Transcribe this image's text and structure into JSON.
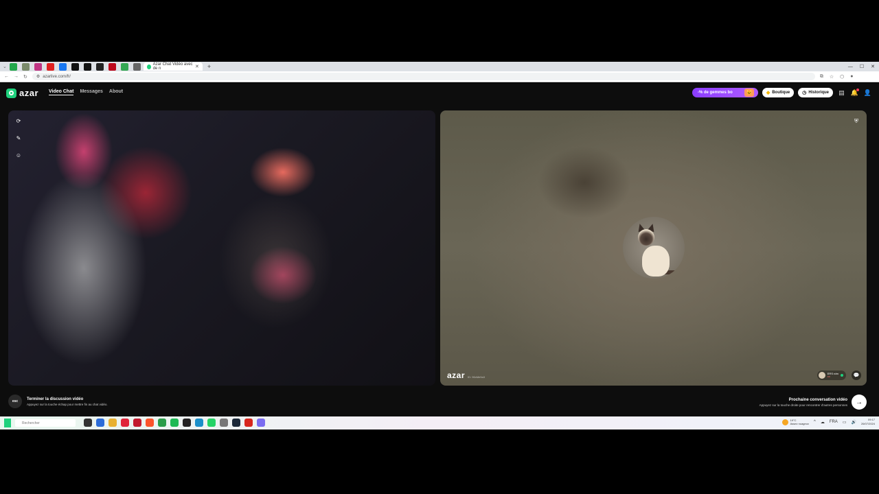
{
  "browser": {
    "active_tab_title": "Azar Chat Vidéo avec de n",
    "url": "azarlive.com/fr/",
    "tab_favicons": [
      {
        "icon": "green-square-icon",
        "color": "#22a84b"
      },
      {
        "icon": "shield-icon",
        "color": "#7a8a6a"
      },
      {
        "icon": "instagram-icon",
        "color": "#c13584"
      },
      {
        "icon": "youtube-icon",
        "color": "#e02020"
      },
      {
        "icon": "facebook-icon",
        "color": "#1877f2"
      },
      {
        "icon": "x-icon",
        "color": "#111111"
      },
      {
        "icon": "x-icon",
        "color": "#111111"
      },
      {
        "icon": "grid-icon",
        "color": "#222222"
      },
      {
        "icon": "pinterest-icon",
        "color": "#bd081c"
      },
      {
        "icon": "drive-icon",
        "color": "#34a853"
      },
      {
        "icon": "gear-icon",
        "color": "#666666"
      }
    ]
  },
  "app": {
    "logo": "azar",
    "nav": {
      "video_chat": "Video Chat",
      "messages": "Messages",
      "about": "About"
    },
    "promo_label": "-% de gemmes bo",
    "boutique_label": "Boutique",
    "historique_label": "Historique",
    "remote": {
      "watermark_logo": "azar",
      "watermark_id": "ID: 96xMe9a3",
      "username": "ERS rdm",
      "username_sub": "FR",
      "status_color": "#1fd17d"
    },
    "bottom": {
      "esc_label": "esc",
      "end_title": "Terminer la discussion vidéo",
      "end_subtitle": "Appuyez sur la touche échap pour mettre fin au chat vidéo.",
      "next_title": "Prochaine conversation vidéo",
      "next_subtitle": "Appuyez sur la touche droite pour rencontrer d'autres personnes"
    }
  },
  "taskbar": {
    "search_placeholder": "Rechercher",
    "weather_temp": "19°C",
    "weather_desc": "Assez nuageux",
    "lang": "FRA",
    "time": "09:17",
    "date": "26/07/2024",
    "apps": [
      {
        "icon": "task-view-icon",
        "color": "#333333"
      },
      {
        "icon": "store-icon",
        "color": "#2b6cd8"
      },
      {
        "icon": "folder-icon",
        "color": "#e8b030"
      },
      {
        "icon": "opera-icon",
        "color": "#e0243a"
      },
      {
        "icon": "opera-gx-icon",
        "color": "#c21a2e"
      },
      {
        "icon": "brave-icon",
        "color": "#fb542b"
      },
      {
        "icon": "chrome-icon",
        "color": "#2a9d4a"
      },
      {
        "icon": "spotify-icon",
        "color": "#1db954"
      },
      {
        "icon": "obs-icon",
        "color": "#222222"
      },
      {
        "icon": "edge-icon",
        "color": "#1a8fc9"
      },
      {
        "icon": "whatsapp-icon",
        "color": "#25d366"
      },
      {
        "icon": "settings-icon",
        "color": "#777777"
      },
      {
        "icon": "steam-icon",
        "color": "#1b2838"
      },
      {
        "icon": "acrobat-icon",
        "color": "#d7261e"
      },
      {
        "icon": "discord-icon",
        "color": "#7b6cf0"
      }
    ]
  }
}
